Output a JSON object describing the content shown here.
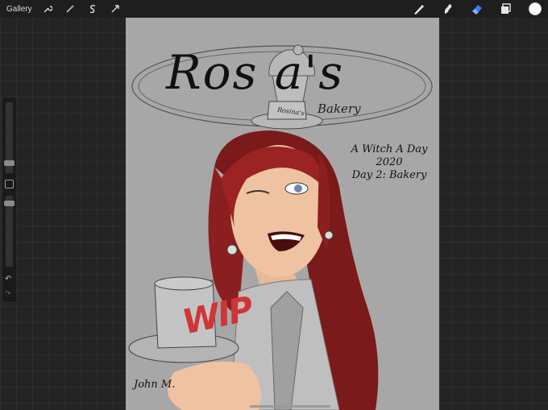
{
  "app": {
    "gallery_label": "Gallery",
    "toolbar_left": [
      "wrench-icon",
      "magic-wand-icon",
      "selection-s-icon",
      "transform-arrow-icon"
    ],
    "toolbar_right": [
      "brush-icon",
      "smudge-icon",
      "eraser-icon",
      "layers-icon",
      "color-swatch"
    ],
    "active_tool": "eraser",
    "accent_color": "#3a7cf0",
    "current_color": "#ffffff"
  },
  "sidebar": {
    "brush_size_level": 0.35,
    "opacity_level": 0.55,
    "undo_icon": "undo-arrow-icon",
    "redo_icon": "redo-arrow-icon"
  },
  "artwork": {
    "logo_title": "Ros   a's",
    "logo_subtitle": "Bakery",
    "hat_label": "Rosina's",
    "event_line1": "A Witch A Day",
    "event_line2": "2020",
    "event_line3": "Day 2: Bakery",
    "wip_stamp": "WIP",
    "signature": "John M."
  }
}
